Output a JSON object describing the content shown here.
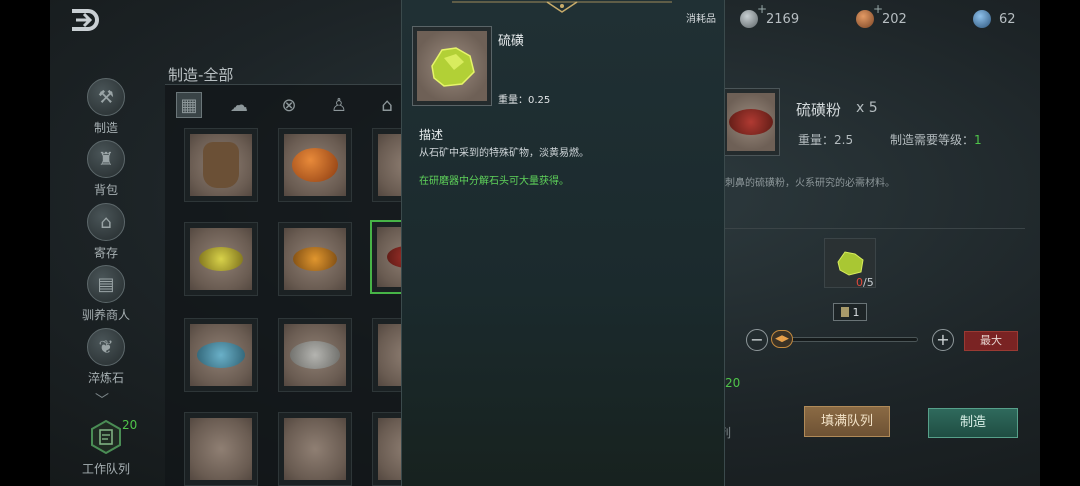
{
  "currencies": [
    {
      "icon": "silver-coin-icon",
      "value": "2169",
      "color": "#9aa3a6"
    },
    {
      "icon": "copper-coin-icon",
      "value": "202",
      "color": "#c4774a"
    },
    {
      "icon": "gem-icon",
      "value": "62",
      "color": "#5a8fc2"
    }
  ],
  "nav": [
    {
      "id": "craft",
      "label": "制造",
      "icon": "hammer-icon"
    },
    {
      "id": "bag",
      "label": "背包",
      "icon": "bag-icon"
    },
    {
      "id": "storage",
      "label": "寄存",
      "icon": "house-icon"
    },
    {
      "id": "tame",
      "label": "驯养商人",
      "icon": "cart-icon"
    },
    {
      "id": "refine",
      "label": "淬炼石",
      "icon": "feather-icon"
    }
  ],
  "side_queue": {
    "count": "20",
    "label": "工作队列"
  },
  "craft_panel": {
    "title": "制造-全部",
    "categories": [
      "grid-icon",
      "ore-icon",
      "sphere-icon",
      "bottle-icon",
      "building-icon"
    ]
  },
  "tooltip": {
    "type": "消耗品",
    "name": "硫磺",
    "weight": "重量：0.25",
    "desc_header": "描述",
    "desc": "从石矿中采到的特殊矿物，淡黄易燃。",
    "source": "在研磨器中分解石头可大量获得。"
  },
  "result": {
    "name": "硫磺粉",
    "qty": "x 5",
    "weight": "重量：2.5",
    "level_label": "制造需要等级：",
    "level_value": "1",
    "desc": "刺鼻的硫磺粉，火系研究的必需材料。"
  },
  "material": {
    "have": "0",
    "need": "/5"
  },
  "quantity": "1",
  "max_label": "最大",
  "center_queue": {
    "count": "20",
    "label": "查看队列"
  },
  "fill_queue_label": "填满队列",
  "craft_label": "制造"
}
